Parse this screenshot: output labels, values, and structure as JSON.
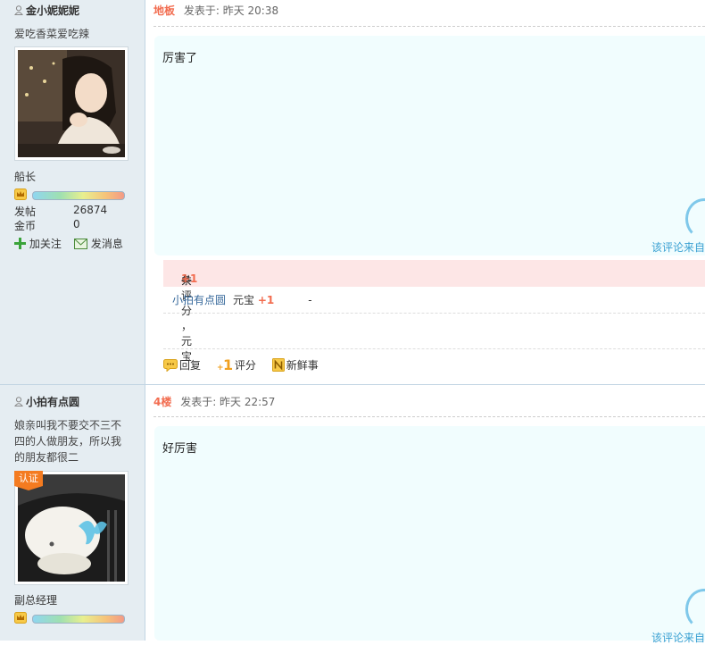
{
  "posts": [
    {
      "username": "金小妮妮妮",
      "signature": "爱吃香菜爱吃辣",
      "rank": "船长",
      "stats": [
        {
          "label": "发帖",
          "value": "26874"
        },
        {
          "label": "金币",
          "value": "0"
        }
      ],
      "actions": {
        "follow": "加关注",
        "message": "发消息"
      },
      "floor": "地板",
      "posted": "发表于: 昨天 20:38",
      "content": "厉害了",
      "source": "该评论来自",
      "rating": {
        "summary_prefix": "共",
        "summary_count": "1",
        "summary_mid": "条评分 ，元宝",
        "summary_value": "+1",
        "rows": [
          {
            "user": "小拍有点圆",
            "kind": "元宝",
            "value": "+1",
            "note": "-"
          }
        ]
      },
      "footer": {
        "reply": "回复",
        "rate": "评分",
        "news": "新鲜事"
      }
    },
    {
      "username": "小拍有点圆",
      "signature": "娘亲叫我不要交不三不四的人做朋友，所以我的朋友都很二",
      "badge": "认证",
      "rank": "副总经理",
      "floor": "4楼",
      "posted": "发表于: 昨天 22:57",
      "content": "好厉害",
      "source": "该评论来自"
    }
  ],
  "colors": {
    "accent": "#f26c4f",
    "link": "#336699",
    "source": "#39a0d2",
    "sidebar": "#e5edf2",
    "content_bg": "#f1fdfe"
  }
}
